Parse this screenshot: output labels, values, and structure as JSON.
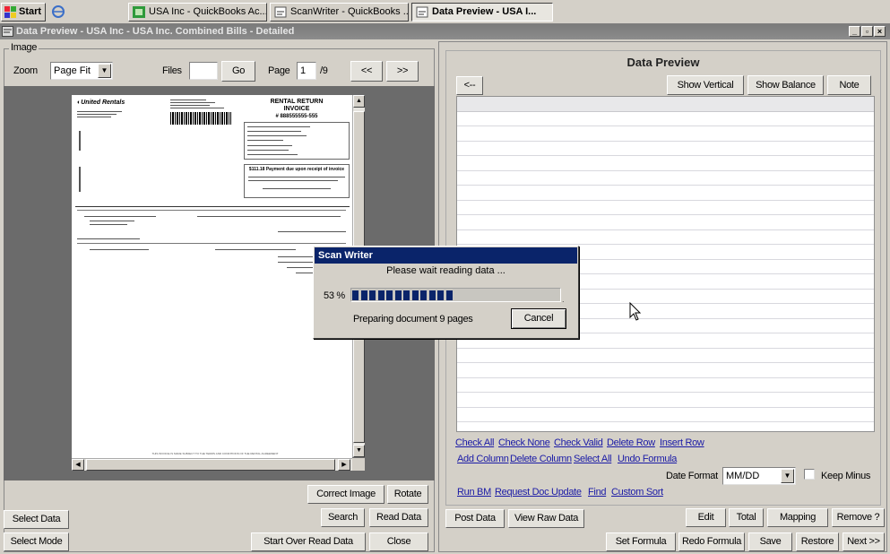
{
  "taskbar": {
    "start_label": "Start",
    "items": [
      {
        "label": "USA Inc - QuickBooks Ac..."
      },
      {
        "label": "ScanWriter - QuickBooks ..."
      },
      {
        "label": "Data Preview - USA I..."
      }
    ]
  },
  "window": {
    "title": "Data Preview - USA Inc - USA Inc. Combined Bills - Detailed",
    "controls": [
      "_",
      "¸",
      "×"
    ]
  },
  "image_panel": {
    "group_label": "Image",
    "zoom_label": "Zoom",
    "zoom_value": "Page Fit",
    "files_label": "Files",
    "files_value": "",
    "go_label": "Go",
    "page_label": "Page",
    "page_value": "1",
    "page_total": "/9",
    "prev_label": "<<",
    "next_label": ">>"
  },
  "document": {
    "company": "United Rentals",
    "title_line1": "RENTAL RETURN",
    "title_line2": "INVOICE",
    "invoice_no": "# 888555555-555",
    "payment_note": "$111.18 Payment due upon receipt of invoice",
    "footer": "THIS INVOICE IS MADE SUBJECT TO THE TERMS AND CONDITIONS OF THE RENTAL AGREEMENT"
  },
  "left_buttons": {
    "correct_image": "Correct Image",
    "rotate": "Rotate",
    "select_data": "Select Data",
    "search": "Search",
    "read_data": "Read Data",
    "select_mode": "Select Mode",
    "start_over": "Start Over Read Data",
    "close": "Close"
  },
  "data_preview": {
    "title": "Data Preview",
    "back": "<--",
    "show_vertical": "Show Vertical",
    "show_balance": "Show Balance",
    "note": "Note"
  },
  "links_row1": [
    "Check All",
    "Check None",
    "Check Valid",
    "Delete Row",
    "Insert Row"
  ],
  "links_row2": [
    "Add Column",
    "Delete Column",
    "Select All",
    "Undo Formula"
  ],
  "links_row3": [
    "Run BM",
    "Request Doc Update",
    "Find",
    "Custom Sort"
  ],
  "date_format": {
    "label": "Date Format",
    "value": "MM/DD",
    "keep_minus": "Keep Minus"
  },
  "right_buttons": {
    "post_data": "Post Data",
    "view_raw": "View Raw Data",
    "edit": "Edit",
    "total": "Total",
    "mapping": "Mapping",
    "remove": "Remove ?",
    "set_formula": "Set Formula",
    "redo_formula": "Redo Formula",
    "save": "Save",
    "restore": "Restore",
    "next": "Next >>"
  },
  "dialog": {
    "title": "Scan Writer",
    "message": "Please wait reading data ...",
    "percent": "53 %",
    "progress": 0.53,
    "status": "Preparing document 9 pages",
    "cancel": "Cancel"
  },
  "colors": {
    "dialog_title_bg": "#0a246a",
    "link": "#1a1aa6",
    "window_bg": "#d4d0c8"
  }
}
